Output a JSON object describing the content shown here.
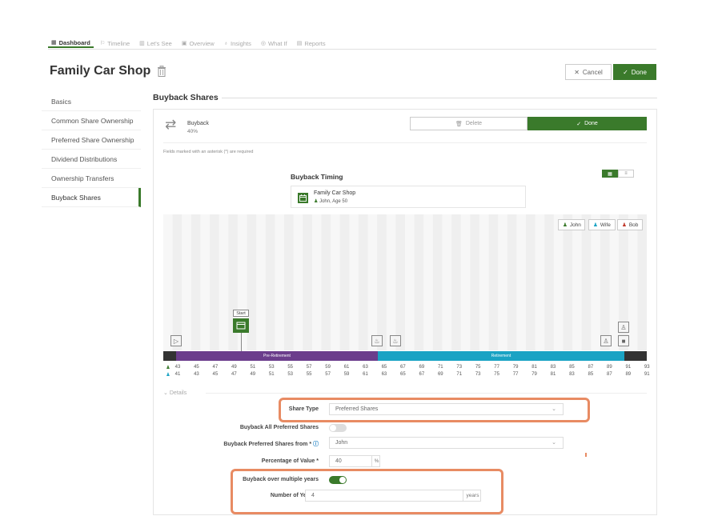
{
  "nav": {
    "items": [
      {
        "label": "Dashboard",
        "icon": "dashboard-icon",
        "active": true
      },
      {
        "label": "Timeline",
        "icon": "flag-icon",
        "active": false
      },
      {
        "label": "Let's See",
        "icon": "bar-chart-icon",
        "active": false
      },
      {
        "label": "Overview",
        "icon": "overview-icon",
        "active": false
      },
      {
        "label": "Insights",
        "icon": "bulb-icon",
        "active": false
      },
      {
        "label": "What If",
        "icon": "target-icon",
        "active": false
      },
      {
        "label": "Reports",
        "icon": "report-icon",
        "active": false
      }
    ]
  },
  "header": {
    "title": "Family Car Shop",
    "cancel_label": "Cancel",
    "done_label": "Done"
  },
  "sidebar": {
    "items": [
      {
        "label": "Basics"
      },
      {
        "label": "Common Share Ownership"
      },
      {
        "label": "Preferred Share Ownership"
      },
      {
        "label": "Dividend Distributions"
      },
      {
        "label": "Ownership Transfers"
      },
      {
        "label": "Buyback Shares"
      }
    ],
    "active_index": 5
  },
  "section": {
    "title": "Buyback Shares"
  },
  "buyback": {
    "title": "Buyback",
    "subtitle": "40%",
    "delete_label": "Delete",
    "done_label": "Done",
    "required_note": "Fields marked with an asterisk (*) are required"
  },
  "timing": {
    "title": "Buyback Timing",
    "shop_name": "Family Car Shop",
    "person": "John, Age 50"
  },
  "legend": [
    {
      "name": "John",
      "color": "#3a7a2b"
    },
    {
      "name": "Wife",
      "color": "#1aa3c4"
    },
    {
      "name": "Bob",
      "color": "#c0392b"
    }
  ],
  "timeline": {
    "start_label": "Start",
    "phases": [
      {
        "label": "Pre-Retirement",
        "color": "#6b3d8c"
      },
      {
        "label": "Retirement",
        "color": "#1aa3c4"
      }
    ],
    "john_ages": [
      "43",
      "45",
      "47",
      "49",
      "51",
      "53",
      "55",
      "57",
      "59",
      "61",
      "63",
      "65",
      "67",
      "69",
      "71",
      "73",
      "75",
      "77",
      "79",
      "81",
      "83",
      "85",
      "87",
      "89",
      "91",
      "93"
    ],
    "wife_ages": [
      "41",
      "43",
      "45",
      "47",
      "49",
      "51",
      "53",
      "55",
      "57",
      "59",
      "61",
      "63",
      "65",
      "67",
      "69",
      "71",
      "73",
      "75",
      "77",
      "79",
      "81",
      "83",
      "85",
      "87",
      "89",
      "91"
    ]
  },
  "details": {
    "label": "Details",
    "share_type_label": "Share Type",
    "share_type_value": "Preferred Shares",
    "buyback_all_label": "Buyback All Preferred Shares",
    "buyback_all_on": false,
    "buyback_from_label": "Buyback Preferred Shares from *",
    "buyback_from_value": "John",
    "percentage_label": "Percentage of Value *",
    "percentage_value": "40",
    "percentage_suffix": "%",
    "multiple_years_label": "Buyback over multiple years",
    "multiple_years_on": true,
    "num_years_label": "Number of Years *",
    "num_years_value": "4",
    "num_years_suffix": "years"
  }
}
